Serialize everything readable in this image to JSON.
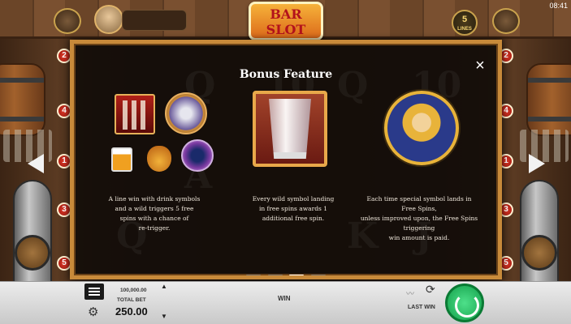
{
  "status": {
    "clock": "08:41"
  },
  "header": {
    "logo_line1": "BAR",
    "logo_line2": "SLOT",
    "lines_count": "5",
    "lines_label": "LINES"
  },
  "paylines": {
    "left": [
      "2",
      "4",
      "1",
      "3",
      "5"
    ],
    "right": [
      "2",
      "4",
      "1",
      "3",
      "5"
    ]
  },
  "reel_symbols": [
    "Q",
    "10",
    "Q",
    "10",
    "A",
    "Q",
    "K",
    "J"
  ],
  "modal": {
    "title": "Bonus Feature",
    "close": "×",
    "columns": [
      {
        "lines": [
          "A line win with drink symbols",
          "and a wild triggers 5 free",
          "spins with a chance of",
          "re-trigger."
        ]
      },
      {
        "lines": [
          "Every wild symbol landing",
          "in free spins awards 1",
          "additional free spin."
        ]
      },
      {
        "lines": [
          "Each time special symbol lands in",
          "Free Spins,",
          "unless improved upon, the Free Spins",
          "triggering",
          "win amount is paid."
        ]
      }
    ],
    "page_count": 4,
    "active_page": 3
  },
  "bottombar": {
    "balance_label": "100,000.00",
    "totalbet_label": "TOTAL BET",
    "totalbet_value": "250.00",
    "bet_up": "▲",
    "bet_down": "▼",
    "win_label": "WIN",
    "lastwin_label": "LAST WIN"
  },
  "icons": {
    "settings": "⚙",
    "autoplay": "⟳",
    "graph": "〰"
  },
  "colors": {
    "frame": "#c88a3a",
    "spin": "#1fbf5a",
    "marker": "#d32f2f"
  }
}
